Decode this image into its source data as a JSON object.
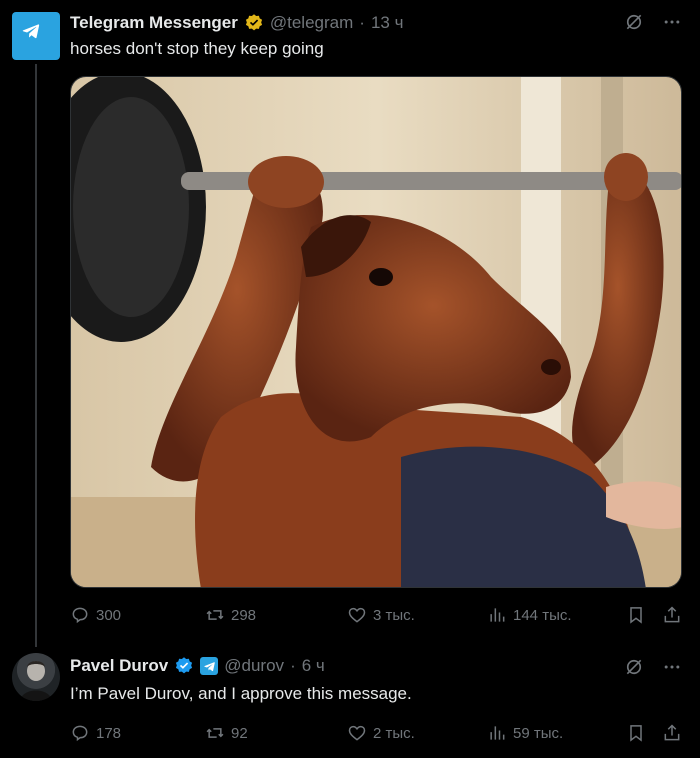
{
  "post1": {
    "display_name": "Telegram Messenger",
    "handle": "@telegram",
    "separator": "·",
    "time": "13 ч",
    "text": "horses don't stop they keep going",
    "stats": {
      "replies": "300",
      "reposts": "298",
      "likes": "3 тыс.",
      "views": "144 тыс."
    }
  },
  "post2": {
    "display_name": "Pavel Durov",
    "handle": "@durov",
    "separator": "·",
    "time": "6 ч",
    "text": "I’m Pavel Durov, and I approve this message.",
    "stats": {
      "replies": "178",
      "reposts": "92",
      "likes": "2 тыс.",
      "views": "59 тыс."
    }
  },
  "colors": {
    "background": "#000000",
    "primary_text": "#e7e9ea",
    "secondary_text": "#71767b",
    "verified_gold": "#e2b719",
    "verified_blue": "#1d9bf0",
    "telegram_blue": "#2aa3e0"
  },
  "icons": [
    "telegram-logo-icon",
    "gold-verified-badge-icon",
    "blue-verified-badge-icon",
    "grok-icon",
    "more-icon",
    "reply-icon",
    "repost-icon",
    "like-icon",
    "views-icon",
    "bookmark-icon",
    "share-icon"
  ]
}
